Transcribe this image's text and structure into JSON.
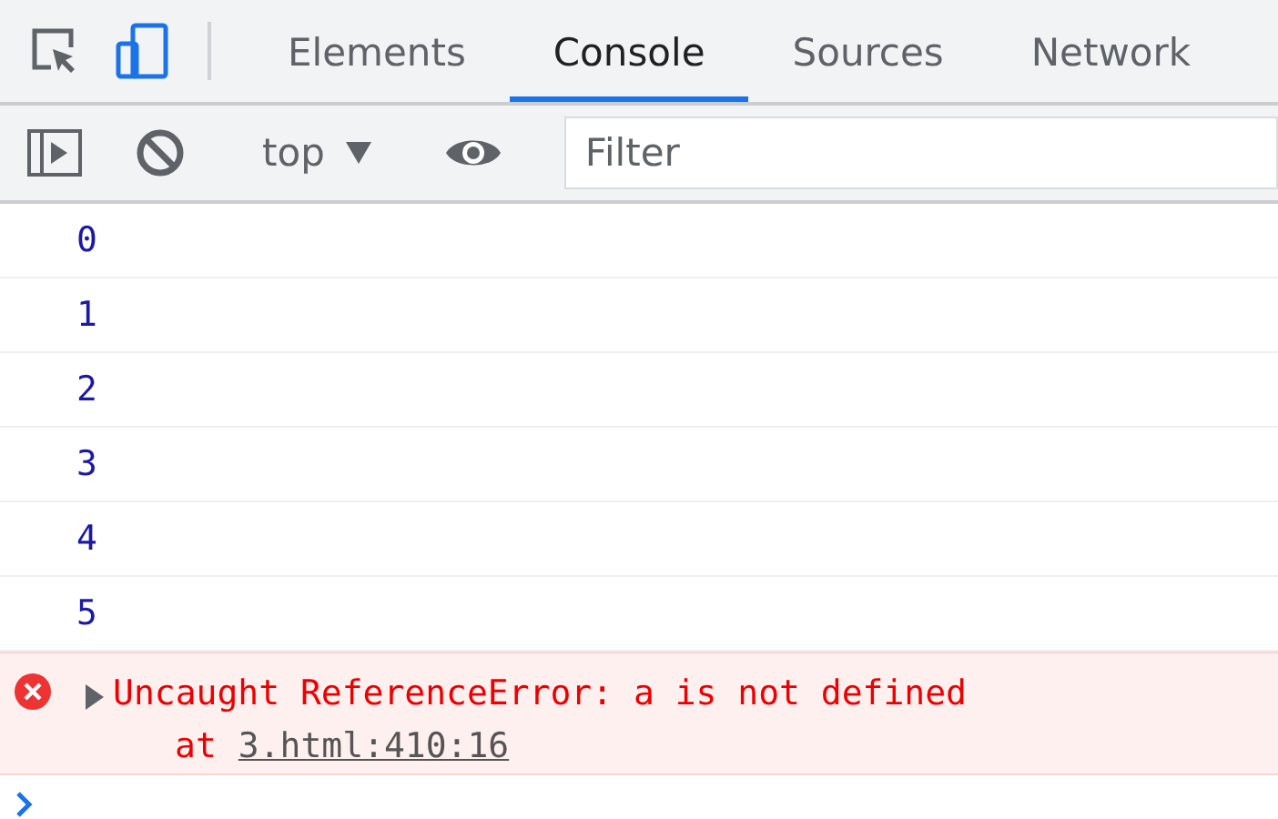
{
  "tabs": [
    {
      "label": "Elements",
      "selected": false
    },
    {
      "label": "Console",
      "selected": true
    },
    {
      "label": "Sources",
      "selected": false
    },
    {
      "label": "Network",
      "selected": false
    }
  ],
  "device_toggle": {
    "on": true
  },
  "toolbar": {
    "context": "top",
    "filter_placeholder": "Filter"
  },
  "log": [
    {
      "kind": "value",
      "text": "0"
    },
    {
      "kind": "value",
      "text": "1"
    },
    {
      "kind": "value",
      "text": "2"
    },
    {
      "kind": "value",
      "text": "3"
    },
    {
      "kind": "value",
      "text": "4"
    },
    {
      "kind": "value",
      "text": "5"
    },
    {
      "kind": "error",
      "text": "Uncaught ReferenceError: a is not defined",
      "expanded": false,
      "stack_prefix": "at",
      "stack_link": "3.html:410:16"
    }
  ]
}
